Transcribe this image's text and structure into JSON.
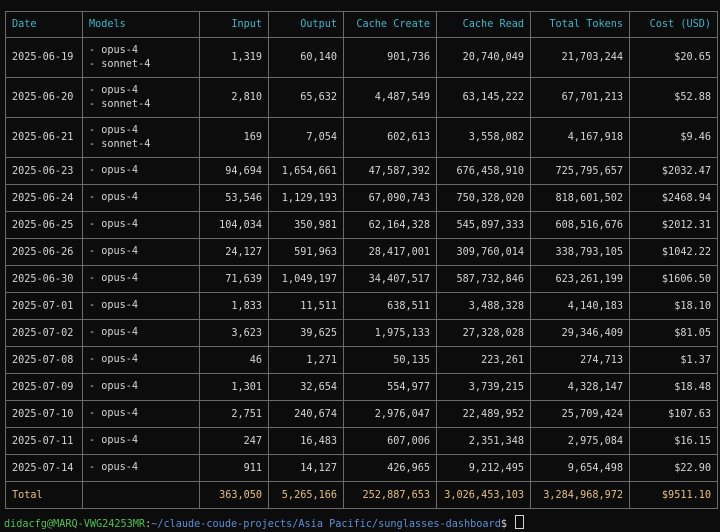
{
  "table": {
    "headers": [
      "Date",
      "Models",
      "Input",
      "Output",
      "Cache Create",
      "Cache Read",
      "Total Tokens",
      "Cost (USD)"
    ],
    "rows": [
      {
        "date": "2025-06-19",
        "models": [
          "- opus-4",
          "- sonnet-4"
        ],
        "input": "1,319",
        "output": "60,140",
        "cache_create": "901,736",
        "cache_read": "20,740,049",
        "total": "21,703,244",
        "cost": "$20.65"
      },
      {
        "date": "2025-06-20",
        "models": [
          "- opus-4",
          "- sonnet-4"
        ],
        "input": "2,810",
        "output": "65,632",
        "cache_create": "4,487,549",
        "cache_read": "63,145,222",
        "total": "67,701,213",
        "cost": "$52.88"
      },
      {
        "date": "2025-06-21",
        "models": [
          "- opus-4",
          "- sonnet-4"
        ],
        "input": "169",
        "output": "7,054",
        "cache_create": "602,613",
        "cache_read": "3,558,082",
        "total": "4,167,918",
        "cost": "$9.46"
      },
      {
        "date": "2025-06-23",
        "models": [
          "- opus-4"
        ],
        "input": "94,694",
        "output": "1,654,661",
        "cache_create": "47,587,392",
        "cache_read": "676,458,910",
        "total": "725,795,657",
        "cost": "$2032.47"
      },
      {
        "date": "2025-06-24",
        "models": [
          "- opus-4"
        ],
        "input": "53,546",
        "output": "1,129,193",
        "cache_create": "67,090,743",
        "cache_read": "750,328,020",
        "total": "818,601,502",
        "cost": "$2468.94"
      },
      {
        "date": "2025-06-25",
        "models": [
          "- opus-4"
        ],
        "input": "104,034",
        "output": "350,981",
        "cache_create": "62,164,328",
        "cache_read": "545,897,333",
        "total": "608,516,676",
        "cost": "$2012.31"
      },
      {
        "date": "2025-06-26",
        "models": [
          "- opus-4"
        ],
        "input": "24,127",
        "output": "591,963",
        "cache_create": "28,417,001",
        "cache_read": "309,760,014",
        "total": "338,793,105",
        "cost": "$1042.22"
      },
      {
        "date": "2025-06-30",
        "models": [
          "- opus-4"
        ],
        "input": "71,639",
        "output": "1,049,197",
        "cache_create": "34,407,517",
        "cache_read": "587,732,846",
        "total": "623,261,199",
        "cost": "$1606.50"
      },
      {
        "date": "2025-07-01",
        "models": [
          "- opus-4"
        ],
        "input": "1,833",
        "output": "11,511",
        "cache_create": "638,511",
        "cache_read": "3,488,328",
        "total": "4,140,183",
        "cost": "$18.10"
      },
      {
        "date": "2025-07-02",
        "models": [
          "- opus-4"
        ],
        "input": "3,623",
        "output": "39,625",
        "cache_create": "1,975,133",
        "cache_read": "27,328,028",
        "total": "29,346,409",
        "cost": "$81.05"
      },
      {
        "date": "2025-07-08",
        "models": [
          "- opus-4"
        ],
        "input": "46",
        "output": "1,271",
        "cache_create": "50,135",
        "cache_read": "223,261",
        "total": "274,713",
        "cost": "$1.37"
      },
      {
        "date": "2025-07-09",
        "models": [
          "- opus-4"
        ],
        "input": "1,301",
        "output": "32,654",
        "cache_create": "554,977",
        "cache_read": "3,739,215",
        "total": "4,328,147",
        "cost": "$18.48"
      },
      {
        "date": "2025-07-10",
        "models": [
          "- opus-4"
        ],
        "input": "2,751",
        "output": "240,674",
        "cache_create": "2,976,047",
        "cache_read": "22,489,952",
        "total": "25,709,424",
        "cost": "$107.63"
      },
      {
        "date": "2025-07-11",
        "models": [
          "- opus-4"
        ],
        "input": "247",
        "output": "16,483",
        "cache_create": "607,006",
        "cache_read": "2,351,348",
        "total": "2,975,084",
        "cost": "$16.15"
      },
      {
        "date": "2025-07-14",
        "models": [
          "- opus-4"
        ],
        "input": "911",
        "output": "14,127",
        "cache_create": "426,965",
        "cache_read": "9,212,495",
        "total": "9,654,498",
        "cost": "$22.90"
      }
    ],
    "totals": {
      "label": "Total",
      "input": "363,050",
      "output": "5,265,166",
      "cache_create": "252,887,653",
      "cache_read": "3,026,453,103",
      "total": "3,284,968,972",
      "cost": "$9511.10"
    }
  },
  "prompt": {
    "user_host": "didacfg@MARQ-VWG24253MR",
    "separator": ":",
    "path": "~/claude-coude-projects/Asia Pacific/sunglasses-dashboard",
    "symbol": "$"
  },
  "colors": {
    "header": "#3ab7c9",
    "total": "#e5c07b",
    "user": "#4fc14f",
    "path": "#5b8fd6"
  }
}
